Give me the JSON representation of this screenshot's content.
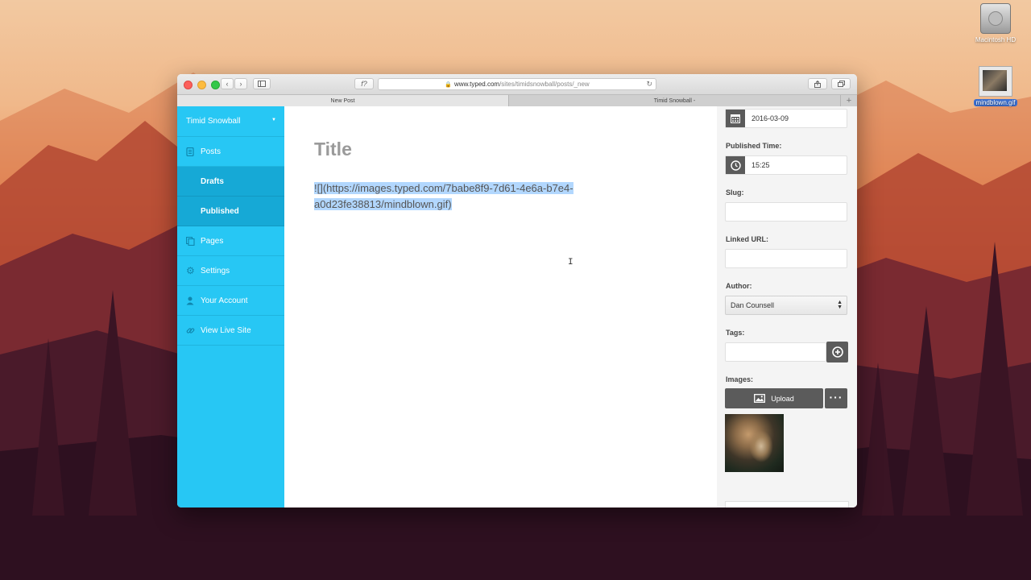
{
  "desktop": {
    "icons": [
      {
        "name": "Macintosh HD",
        "type": "drive"
      },
      {
        "name": "mindblown.gif",
        "type": "image"
      }
    ]
  },
  "browser": {
    "url_domain": "www.typed.com",
    "url_path": "/sites/timidsnowball/posts/_new",
    "reader_glyph": "f?",
    "tabs": [
      {
        "label": "New Post",
        "active": true
      },
      {
        "label": "Timid Snowball -",
        "active": false
      }
    ]
  },
  "sidebar": {
    "site_name": "Timid Snowball",
    "items": [
      {
        "label": "Posts",
        "icon": "document-icon"
      },
      {
        "label": "Drafts",
        "sub": true
      },
      {
        "label": "Published",
        "sub": true
      },
      {
        "label": "Pages",
        "icon": "pages-icon"
      },
      {
        "label": "Settings",
        "icon": "gear-icon"
      },
      {
        "label": "Your Account",
        "icon": "user-icon"
      },
      {
        "label": "View Live Site",
        "icon": "link-icon"
      }
    ]
  },
  "editor": {
    "title_placeholder": "Title",
    "body": "![](https://images.typed.com/7babe8f9-7d61-4e6a-b7e4-a0d23fe38813/mindblown.gif)"
  },
  "panel": {
    "date_value": "2016-03-09",
    "published_time_label": "Published Time:",
    "time_value": "15:25",
    "slug_label": "Slug:",
    "slug_value": "",
    "linked_url_label": "Linked URL:",
    "linked_url_value": "",
    "author_label": "Author:",
    "author_value": "Dan Counsell",
    "tags_label": "Tags:",
    "tags_value": "",
    "images_label": "Images:",
    "upload_label": "Upload"
  },
  "colors": {
    "sidebar": "#27c7f4",
    "sidebar_sub": "#16a9d6",
    "dark_button": "#5b5b5b",
    "selection": "#b2d7fe"
  }
}
